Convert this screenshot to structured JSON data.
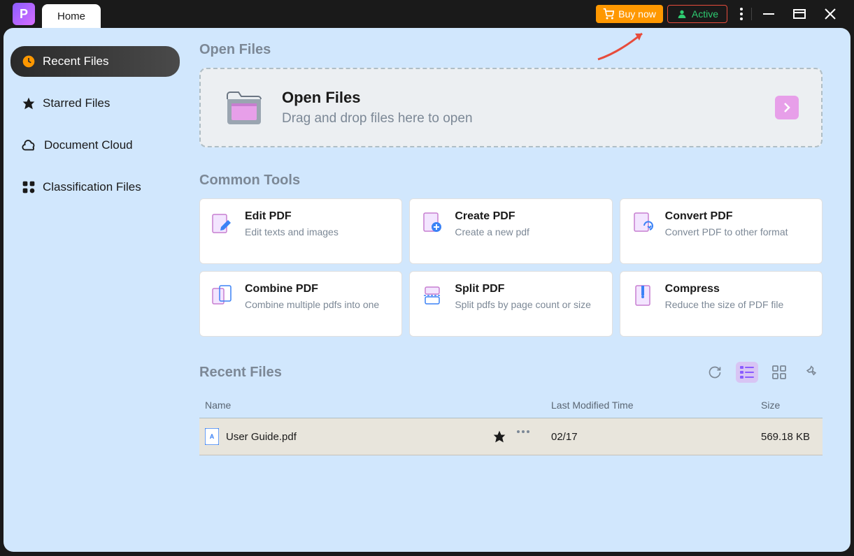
{
  "titlebar": {
    "tab_label": "Home",
    "buy_label": "Buy now",
    "active_label": "Active"
  },
  "sidebar": {
    "items": [
      {
        "label": "Recent Files"
      },
      {
        "label": "Starred Files"
      },
      {
        "label": "Document Cloud"
      },
      {
        "label": "Classification Files"
      }
    ]
  },
  "open_section": {
    "title": "Open Files",
    "heading": "Open Files",
    "subtext": "Drag and drop files here to open"
  },
  "tools_section": {
    "title": "Common Tools",
    "cards": [
      {
        "title": "Edit PDF",
        "desc": "Edit texts and images"
      },
      {
        "title": "Create PDF",
        "desc": "Create a new pdf"
      },
      {
        "title": "Convert PDF",
        "desc": "Convert PDF to other format"
      },
      {
        "title": "Combine PDF",
        "desc": "Combine multiple pdfs into one"
      },
      {
        "title": "Split PDF",
        "desc": "Split pdfs by page count or size"
      },
      {
        "title": "Compress",
        "desc": "Reduce the size of PDF file"
      }
    ]
  },
  "recent_section": {
    "title": "Recent Files",
    "columns": {
      "name": "Name",
      "date": "Last Modified Time",
      "size": "Size"
    },
    "rows": [
      {
        "name": "User Guide.pdf",
        "date": "02/17",
        "size": "569.18 KB"
      }
    ]
  }
}
